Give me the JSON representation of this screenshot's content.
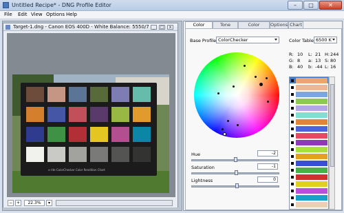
{
  "window": {
    "title": "Untitled Recipe* - DNG Profile Editor",
    "minimize": "–",
    "maximize": "□",
    "close": "✕"
  },
  "menu": {
    "file": "File",
    "edit": "Edit",
    "view": "View",
    "options": "Options",
    "help": "Help"
  },
  "document": {
    "title": "Target-1.dng - Canon EOS 400D - White Balance: 5550/7",
    "zoom": "22.3%",
    "chart_caption": "x-rite ColorChecker Color Rendition Chart"
  },
  "colors": {
    "patches": [
      "#6e4c3c",
      "#c59683",
      "#5a7596",
      "#58693a",
      "#7e7db3",
      "#66bcab",
      "#d47f2b",
      "#4556a6",
      "#c1505a",
      "#5a3a6a",
      "#98b843",
      "#e09b2c",
      "#2f3b8f",
      "#3f9146",
      "#b12f35",
      "#e3c621",
      "#b2508f",
      "#0b86a4",
      "#f1f1ee",
      "#c9c9c6",
      "#a2a29f",
      "#7a7a78",
      "#545453",
      "#333332"
    ],
    "swatches": [
      "#e6a770",
      "#e9b79a",
      "#78a8df",
      "#8dcb50",
      "#b3a7e8",
      "#7fe0d0",
      "#e08634",
      "#4b63e0",
      "#e24b64",
      "#8e3ab8",
      "#a8e040",
      "#e6a020",
      "#3a4ed0",
      "#48b048",
      "#d03030",
      "#e0d020",
      "#b850d8",
      "#18a0c8",
      "#e8d0b0",
      "#c8c8c8"
    ]
  },
  "right_panel": {
    "tabs": [
      "Color Tables",
      "Tone Curve",
      "Color Matrices",
      "Options",
      "Chart"
    ],
    "base_profile_label": "Base Profile:",
    "base_profile_value": "ColorChecker",
    "color_table_label": "Color Table:",
    "color_table_value": "6500 K",
    "readout": {
      "r": "R:",
      "r_val": "10",
      "l": "L:",
      "l_val": "21",
      "h": "H:",
      "h_val": "244",
      "g": "G:",
      "g_val": "8",
      "a": "a:",
      "a_val": "13",
      "s": "S:",
      "s_val": "80",
      "b": "B:",
      "b_val": "40",
      "b2": "b:",
      "b2_val": "-44",
      "l2": "L:",
      "l2_val": "16"
    },
    "hue_label": "Hue",
    "hue_value": "-2",
    "saturation_label": "Saturation",
    "saturation_value": "-1",
    "lightness_label": "Lightness",
    "lightness_value": "0"
  }
}
